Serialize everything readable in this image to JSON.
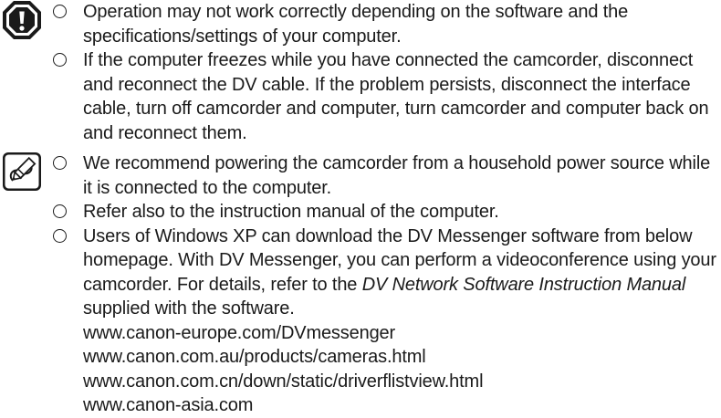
{
  "caution": {
    "icon": "caution-exclamation-icon",
    "items": [
      "Operation may not work correctly depending on the software and the specifications/settings of your computer.",
      "If the computer freezes while you have connected the camcorder, disconnect and reconnect the DV cable. If the problem persists, disconnect the interface cable, turn off camcorder and computer, turn camcorder and computer back on and reconnect them."
    ]
  },
  "note": {
    "icon": "note-pencil-icon",
    "items": [
      "We recommend powering the camcorder from a household power source while it is connected to the computer.",
      "Refer also to the instruction manual of the computer."
    ],
    "download": {
      "text_before": "Users of Windows XP can download the DV Messenger software from below homepage. With DV Messenger, you can perform a videoconference using your camcorder. For details, refer to the ",
      "manual_title": "DV Network Software Instruction Manual",
      "text_after": " supplied with the software.",
      "urls": [
        "www.canon-europe.com/DVmessenger",
        "www.canon.com.au/products/cameras.html",
        "www.canon.com.cn/down/static/driverflistview.html",
        "www.canon-asia.com"
      ]
    }
  }
}
